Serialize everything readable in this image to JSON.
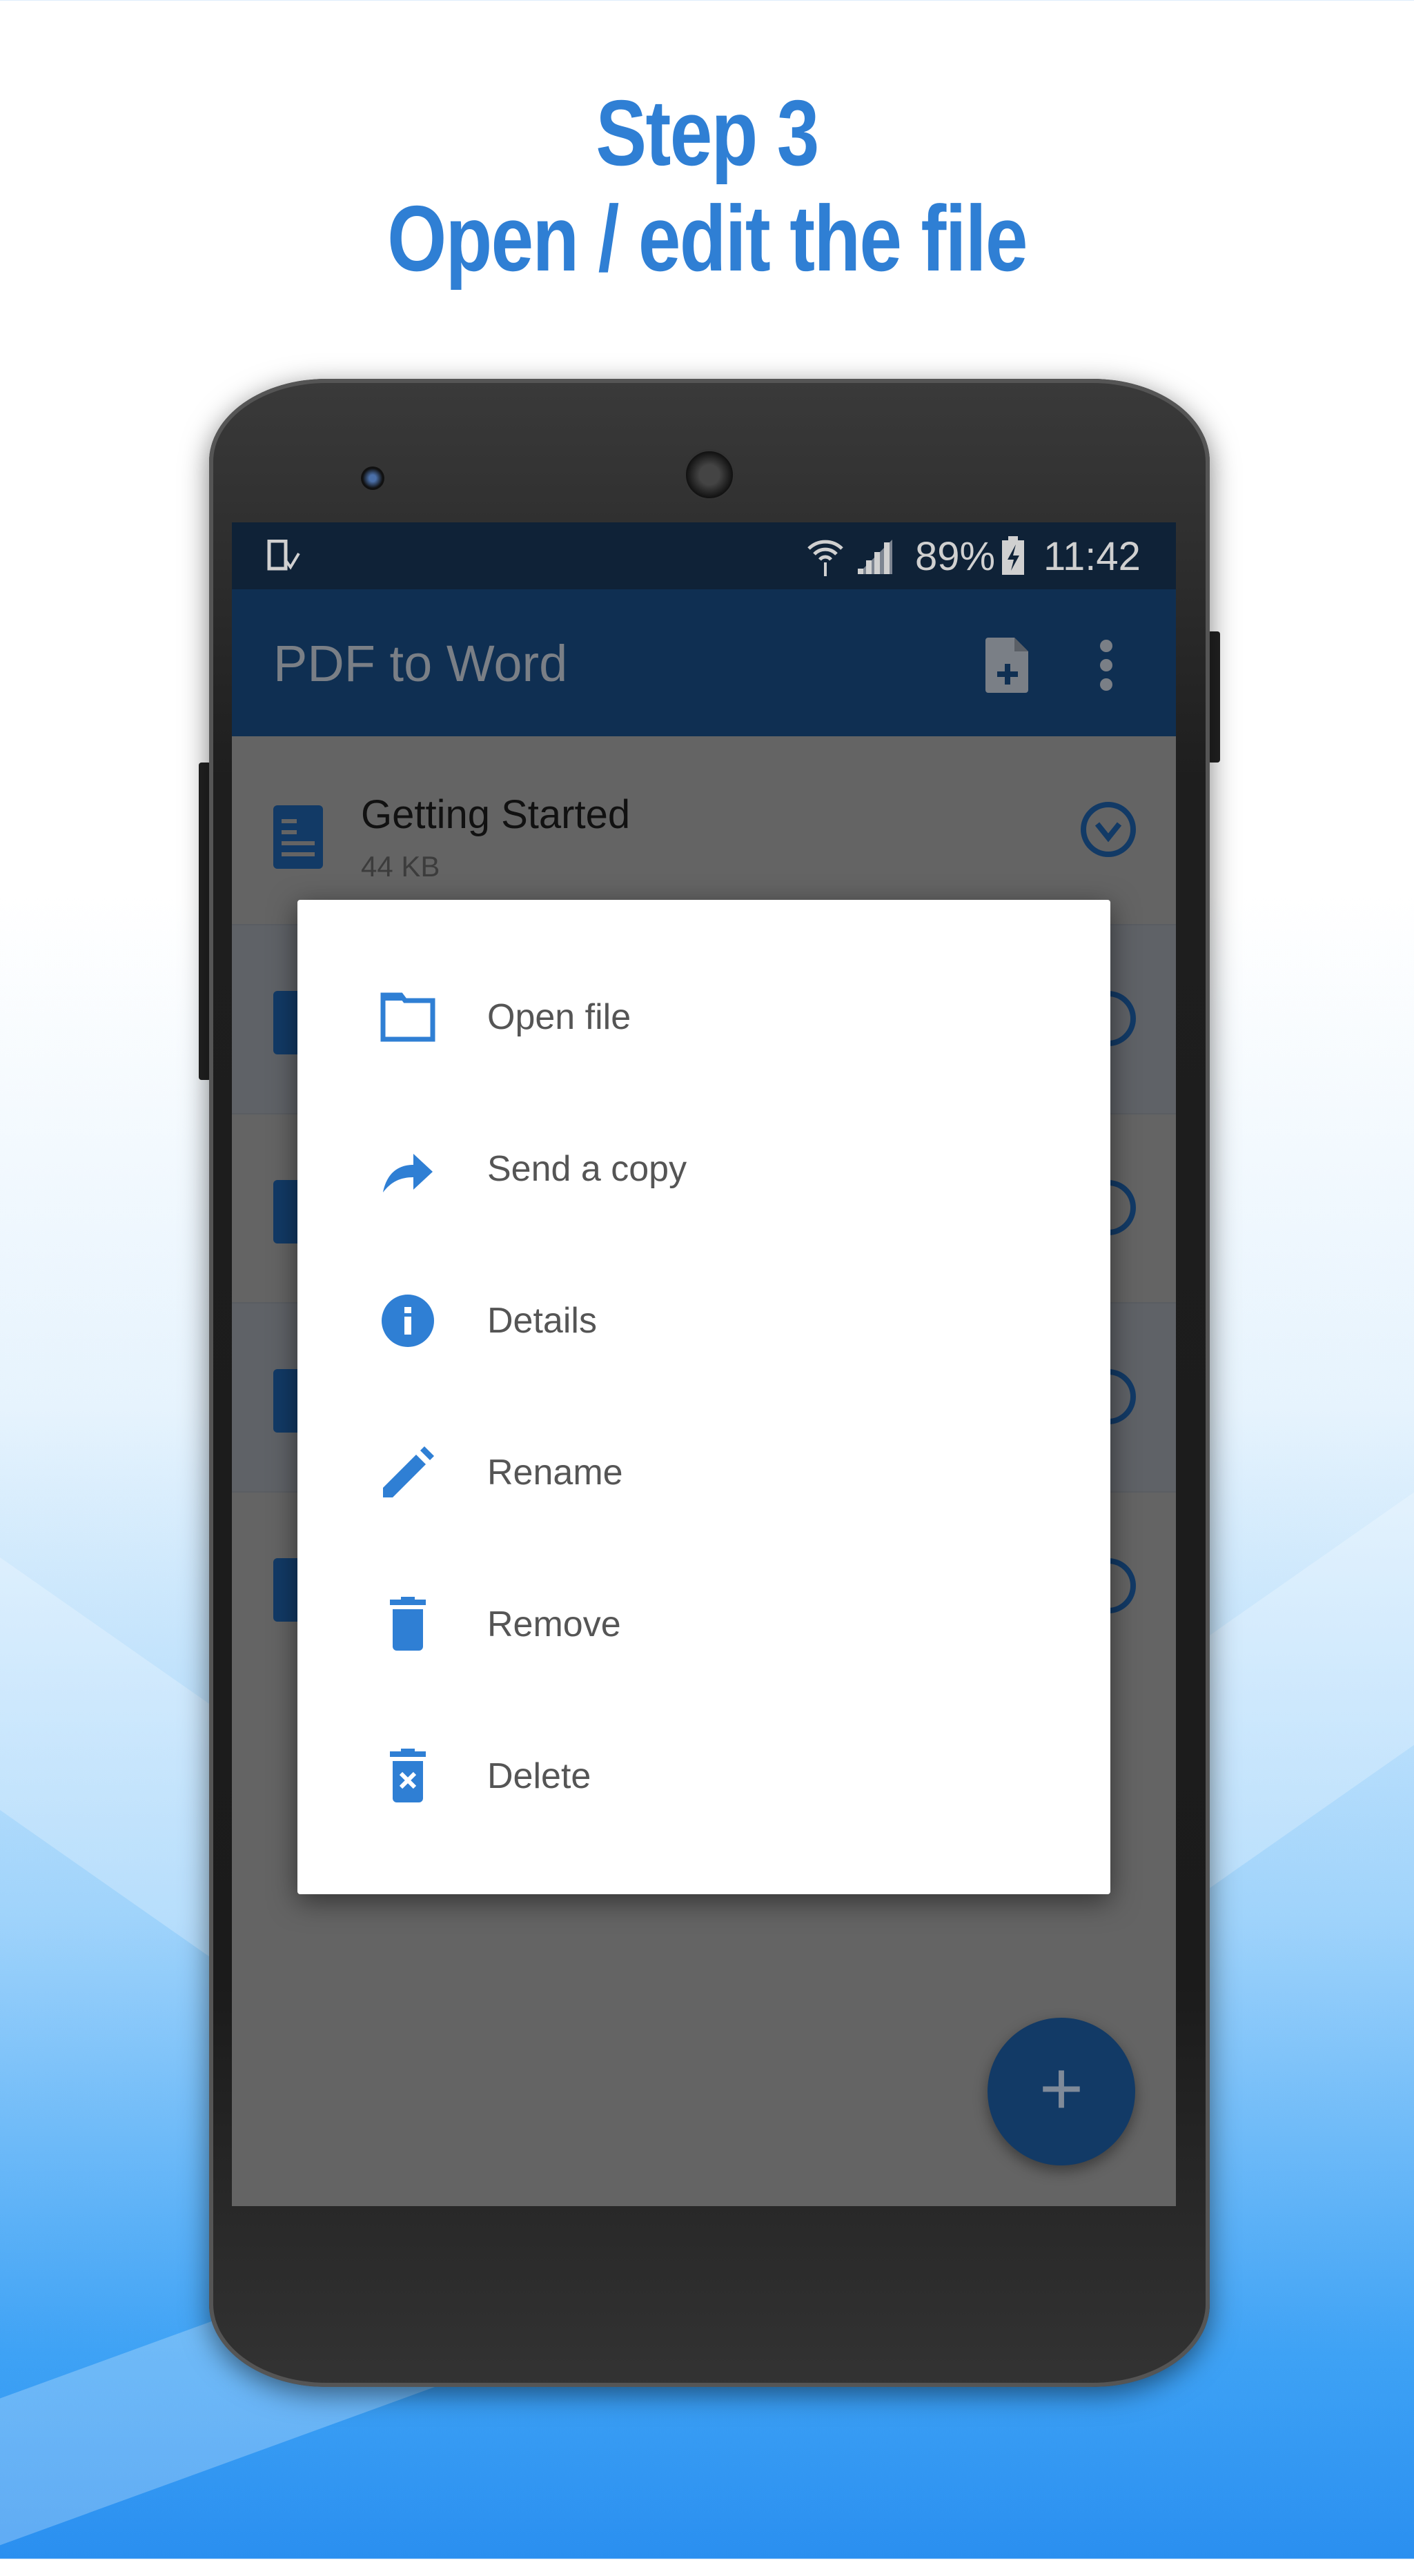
{
  "headline": {
    "line1": "Step 3",
    "line2": "Open / edit the file"
  },
  "status_bar": {
    "battery": "89%",
    "time": "11:42"
  },
  "app_bar": {
    "title": "PDF to Word"
  },
  "files": [
    {
      "name": "Getting Started",
      "size": "44 KB"
    }
  ],
  "dialog": {
    "items": [
      {
        "label": "Open file",
        "icon": "folder-icon"
      },
      {
        "label": "Send a copy",
        "icon": "share-icon"
      },
      {
        "label": "Details",
        "icon": "info-icon"
      },
      {
        "label": "Rename",
        "icon": "pencil-icon"
      },
      {
        "label": "Remove",
        "icon": "trash-icon"
      },
      {
        "label": "Delete",
        "icon": "delete-forever-icon"
      }
    ]
  },
  "fab": {
    "label": "+"
  },
  "colors": {
    "accent": "#2f7fd4",
    "app_bar": "#0f2f52",
    "status_bar": "#0f2237"
  }
}
